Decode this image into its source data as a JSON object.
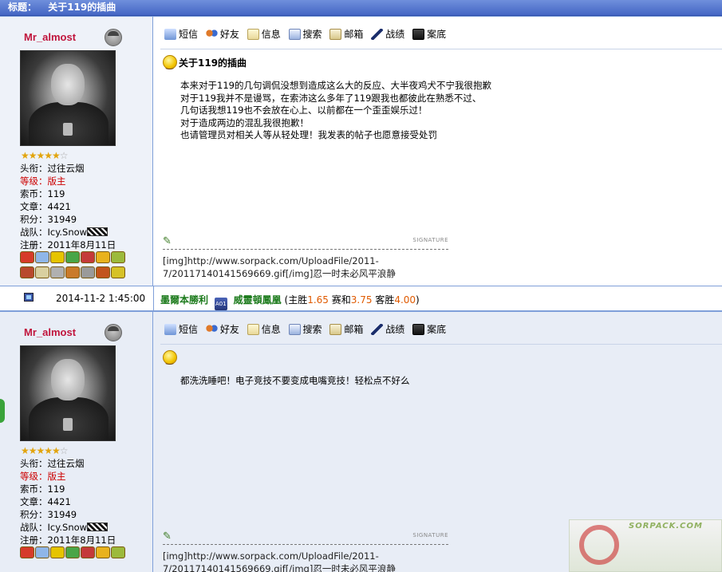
{
  "thread": {
    "label": "标题：",
    "title": "关于119的插曲"
  },
  "toolbar": {
    "items": [
      {
        "label": "短信",
        "icon": "message-icon"
      },
      {
        "label": "好友",
        "icon": "friends-icon"
      },
      {
        "label": "信息",
        "icon": "info-icon"
      },
      {
        "label": "搜索",
        "icon": "search-icon"
      },
      {
        "label": "邮箱",
        "icon": "mailbox-icon"
      },
      {
        "label": "战绩",
        "icon": "record-icon"
      },
      {
        "label": "案底",
        "icon": "case-file-icon"
      }
    ]
  },
  "posts": [
    {
      "user": {
        "name": "Mr_almost",
        "stars": 5,
        "title_label": "头衔：",
        "title": "过往云烟",
        "level_label": "等级：",
        "level": "版主",
        "coins_label": "索币：",
        "coins": "119",
        "articles_label": "文章：",
        "articles": "4421",
        "points_label": "积分：",
        "points": "31949",
        "team_label": "战队：",
        "team": "Icy.Snow",
        "registered_label": "注册：",
        "registered": "2011年8月11日"
      },
      "title": "关于119的插曲",
      "body": [
        "本来对于119的几句调侃没想到造成这么大的反应、大半夜鸡犬不宁我很抱歉",
        "对于119我并不是谩骂，在索沛这么多年了119跟我也都彼此在熟悉不过、",
        "几句话我想119也不会放在心上、以前都在一个歪歪娱乐过！",
        "对于造成两边的混乱我很抱歉！",
        "也请管理员对相关人等从轻处理！我发表的帖子也愿意接受处罚"
      ],
      "signature_label": "SIGNATURE",
      "signature": [
        "[img]http://www.sorpack.com/UploadFile/2011-",
        "7/20117140141569669.gif[/img]忍一时未必风平浪静"
      ]
    },
    {
      "user": {
        "name": "Mr_almost",
        "stars": 5,
        "title_label": "头衔：",
        "title": "过往云烟",
        "level_label": "等级：",
        "level": "版主",
        "coins_label": "索币：",
        "coins": "119",
        "articles_label": "文章：",
        "articles": "4421",
        "points_label": "积分：",
        "points": "31949",
        "team_label": "战队：",
        "team": "Icy.Snow",
        "registered_label": "注册：",
        "registered": "2011年8月11日"
      },
      "title": "",
      "body": [
        "都洗洗睡吧！电子竞技不要变成电嘴竞技！轻松点不好么"
      ],
      "signature_label": "SIGNATURE",
      "signature": [
        "[img]http://www.sorpack.com/UploadFile/2011-",
        "7/20117140141569669.gif[/img]忍一时未必风平浪静"
      ]
    }
  ],
  "separator": {
    "date": "2014-11-2 1:45:00",
    "home_team": "墨爾本勝利",
    "away_team": "威靈頓鳳凰",
    "odds_prefix": "(主胜",
    "home_odds": "1.65",
    "draw_label": "赛和",
    "draw_odds": "3.75",
    "away_label": "客胜",
    "away_odds": "4.00",
    "odds_suffix": ")"
  },
  "logo": {
    "text_top": "SORPACK.COM"
  },
  "colors": {
    "title_bar": "#4466c4",
    "border": "#7f9fd9",
    "username": "#c0143c",
    "level": "#cc0000",
    "team_names": "#1b7a1b",
    "odds": "#e05a00"
  }
}
